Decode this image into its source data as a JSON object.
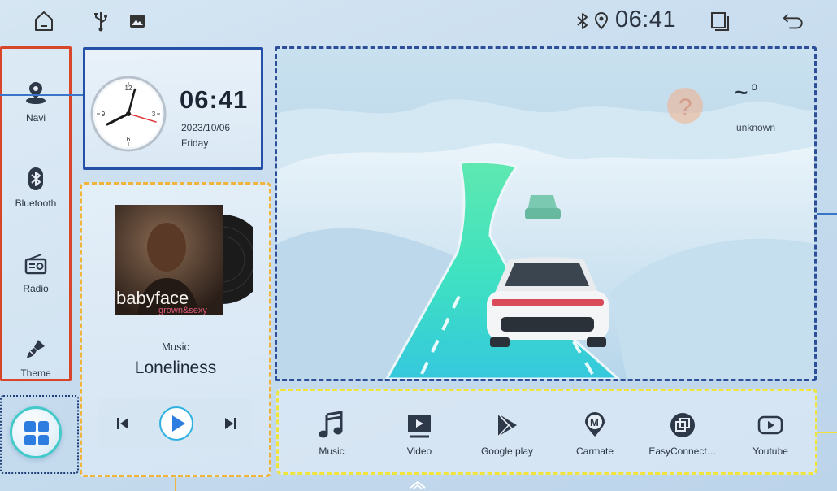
{
  "status_bar": {
    "time": "06:41",
    "icons": [
      "home-icon",
      "usb-icon",
      "image-icon",
      "bluetooth-icon",
      "location-icon",
      "recent-apps-icon",
      "back-icon"
    ]
  },
  "sidebar": {
    "items": [
      {
        "label": "Navi",
        "icon": "navigation-icon"
      },
      {
        "label": "Bluetooth",
        "icon": "bluetooth-icon"
      },
      {
        "label": "Radio",
        "icon": "radio-icon"
      },
      {
        "label": "Theme",
        "icon": "brush-icon"
      }
    ]
  },
  "clock": {
    "time": "06:41",
    "date": "2023/10/06",
    "day": "Friday"
  },
  "music": {
    "label": "Music",
    "title": "Loneliness",
    "album_text_top": "babyface",
    "album_text_bottom": "grown&sexy"
  },
  "weather": {
    "temp": "~",
    "degree": "o",
    "desc": "unknown"
  },
  "dock": {
    "items": [
      {
        "label": "Music",
        "icon": "music-note-icon"
      },
      {
        "label": "Video",
        "icon": "video-icon"
      },
      {
        "label": "Google play",
        "icon": "play-store-icon"
      },
      {
        "label": "Carmate",
        "icon": "carmate-icon"
      },
      {
        "label": "EasyConnect…",
        "icon": "easyconnect-icon"
      },
      {
        "label": "Youtube",
        "icon": "youtube-icon"
      }
    ]
  },
  "colors": {
    "sidebar_border": "#d8462a",
    "clock_border": "#2450a8",
    "music_border": "#f0b43a",
    "scene_border": "#2d4f9a",
    "dock_border": "#f0e43a",
    "accent": "#2d7de0"
  }
}
